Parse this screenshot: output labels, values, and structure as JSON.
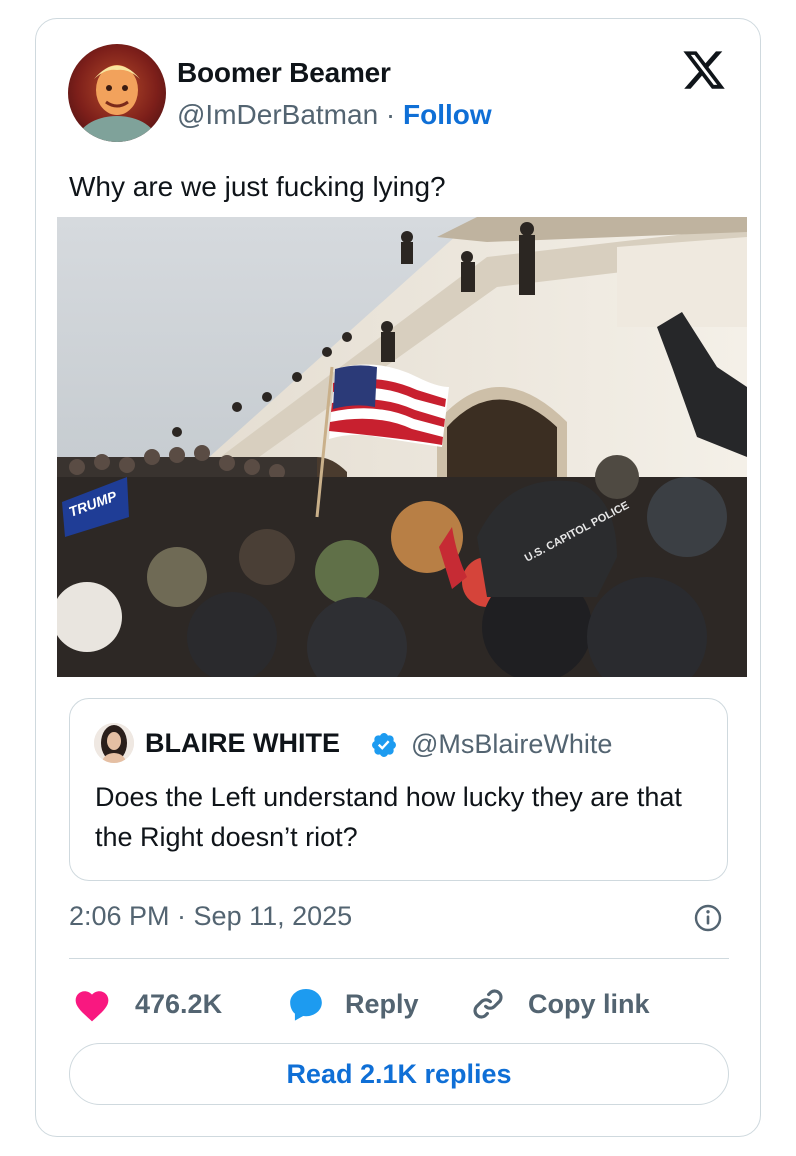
{
  "author": {
    "name": "Boomer Beamer",
    "handle": "@ImDerBatman",
    "separator": " · ",
    "follow_label": "Follow"
  },
  "tweet_text": "Why are we just fucking lying?",
  "photo": {
    "flag_text": "TRUMP",
    "helmet_text": "U.S. CAPITOL POLICE"
  },
  "quoted": {
    "name": "BLAIRE WHITE",
    "handle": "@MsBlaireWhite",
    "verified": true,
    "text": "Does the Left understand how lucky they are that the Right doesn’t riot?"
  },
  "timestamp": "2:06 PM · Sep 11, 2025",
  "actions": {
    "like_count": "476.2K",
    "reply_label": "Reply",
    "copy_label": "Copy link"
  },
  "read_replies_label": "Read 2.1K replies",
  "colors": {
    "accent": "#0f6fd6",
    "like": "#f91880",
    "reply_icon": "#1d9bf0",
    "verified": "#1d9bf0",
    "muted": "#536471",
    "border": "#cfd9de"
  },
  "icons": {
    "brand": "x-logo-icon",
    "verified": "verified-badge-icon",
    "info": "info-icon",
    "like": "heart-icon",
    "reply": "reply-bubble-icon",
    "copy": "link-icon"
  }
}
